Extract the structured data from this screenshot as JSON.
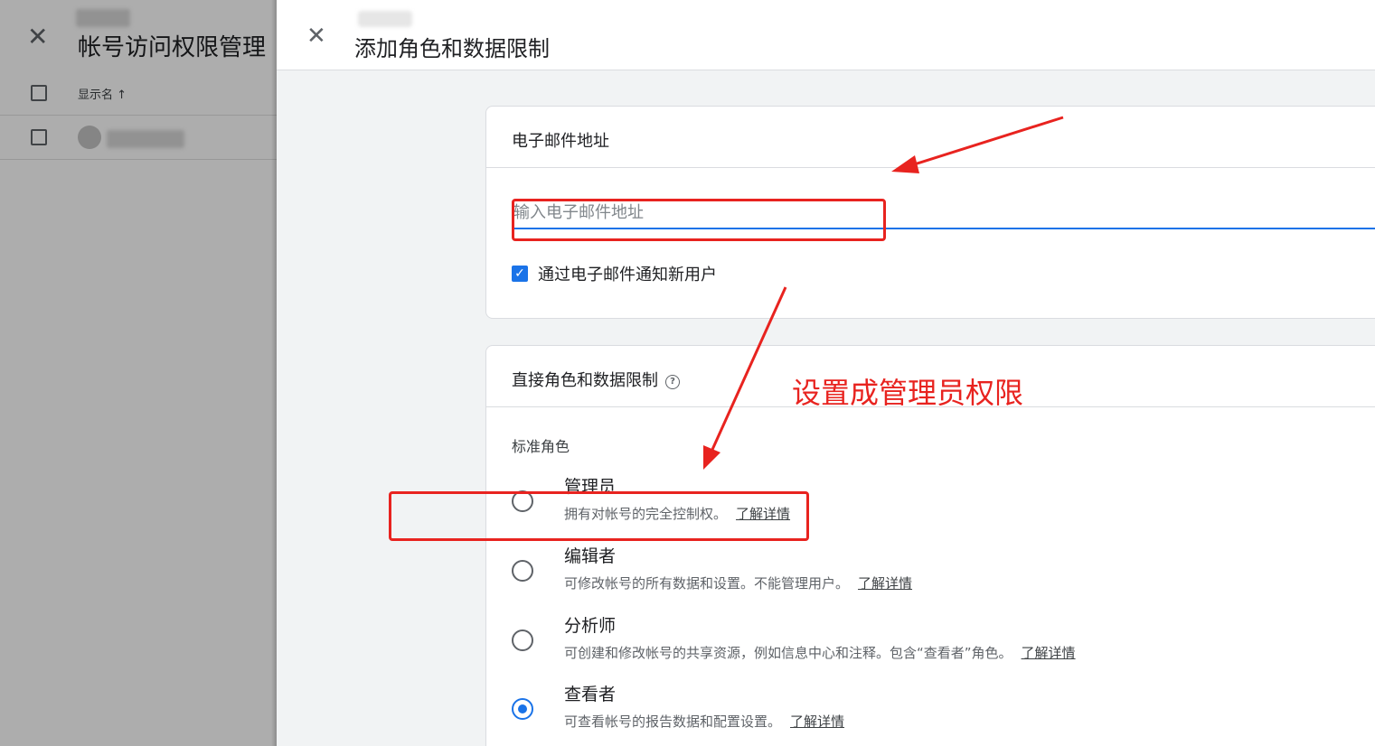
{
  "background_page": {
    "title": "帐号访问权限管理",
    "column_label": "显示名 ↑"
  },
  "dialog": {
    "title": "添加角色和数据限制",
    "email_card": {
      "heading": "电子邮件地址",
      "input_placeholder": "输入电子邮件地址",
      "input_value": "",
      "notify_label": "通过电子邮件通知新用户",
      "notify_checked": true
    },
    "roles_card": {
      "heading": "直接角色和数据限制",
      "section_label": "标准角色",
      "learn_more": "了解详情",
      "roles": [
        {
          "name": "管理员",
          "description": "拥有对帐号的完全控制权。",
          "selected": false
        },
        {
          "name": "编辑者",
          "description": "可修改帐号的所有数据和设置。不能管理用户。",
          "selected": false
        },
        {
          "name": "分析师",
          "description": "可创建和修改帐号的共享资源，例如信息中心和注释。包含“查看者”角色。",
          "selected": false
        },
        {
          "name": "查看者",
          "description": "可查看帐号的报告数据和配置设置。",
          "selected": true
        }
      ]
    }
  },
  "annotation": {
    "text": "设置成管理员权限",
    "color": "#e8231f"
  },
  "colors": {
    "accent": "#1a73e8",
    "panel_background": "#f1f3f4"
  }
}
